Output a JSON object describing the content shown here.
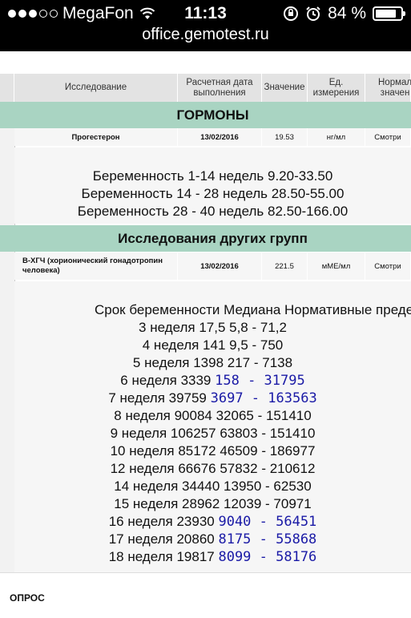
{
  "status_bar": {
    "carrier": "MegaFon",
    "time": "11:13",
    "battery_percent": "84 %",
    "battery_level": 0.84,
    "icons": [
      "signal-dots-icon",
      "wifi-icon",
      "orientation-lock-icon",
      "alarm-icon",
      "battery-icon"
    ]
  },
  "browser": {
    "url": "office.gemotest.ru"
  },
  "table": {
    "headers": {
      "research": "Исследование",
      "date": "Расчетная дата выполнения",
      "value": "Значение",
      "unit": "Ед. измерения",
      "norm": "Нормал значен"
    },
    "sections": [
      {
        "title": "ГОРМОНЫ",
        "row": {
          "name": "Прогестерон",
          "date": "13/02/2016",
          "value": "19.53",
          "unit": "нг/мл",
          "norm": "Смотри"
        },
        "notes": [
          "Беременность 1-14 недель 9.20-33.50",
          "Беременность 14 - 28 недель 28.50-55.00",
          "Беременность 28 - 40 недель 82.50-166.00"
        ]
      },
      {
        "title": "Исследования других групп",
        "row": {
          "name": "В-ХГЧ (хорионический гонадотропин человека)",
          "date": "13/02/2016",
          "value": "221.5",
          "unit": "мМЕ/мл",
          "norm": "Смотри"
        },
        "notes_header": "Срок беременности Медиана Нормативные преде",
        "notes": [
          {
            "text": "3 неделя 17,5 5,8 - 71,2",
            "range": ""
          },
          {
            "text": "4 неделя 141 9,5 - 750",
            "range": ""
          },
          {
            "text": "5 неделя 1398 217 - 7138",
            "range": ""
          },
          {
            "text": "6 неделя 3339 ",
            "range": "158 - 31795"
          },
          {
            "text": "7 неделя 39759 ",
            "range": "3697 - 163563"
          },
          {
            "text": "8 неделя 90084 32065 - 151410",
            "range": ""
          },
          {
            "text": "9 неделя 106257 63803 - 151410",
            "range": ""
          },
          {
            "text": "10 неделя 85172 46509 - 186977",
            "range": ""
          },
          {
            "text": "12 неделя 66676 57832 - 210612",
            "range": ""
          },
          {
            "text": "14 неделя 34440 13950 - 62530",
            "range": ""
          },
          {
            "text": "15 неделя 28962 12039 - 70971",
            "range": ""
          },
          {
            "text": "16 неделя 23930 ",
            "range": "9040 - 56451"
          },
          {
            "text": "17 неделя 20860 ",
            "range": "8175 - 55868"
          },
          {
            "text": "18 неделя 19817 ",
            "range": "8099 - 58176"
          }
        ]
      }
    ]
  },
  "footer": {
    "label": "ОПРОС"
  }
}
